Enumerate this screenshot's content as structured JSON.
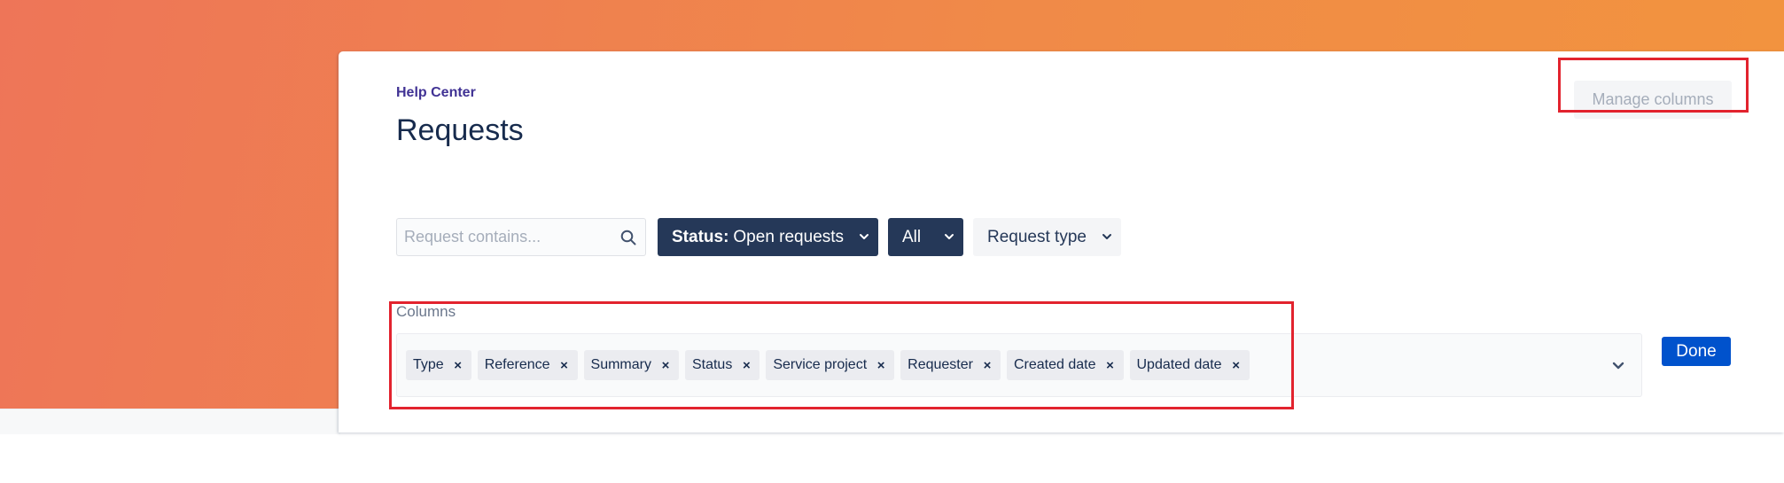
{
  "page": {
    "eyebrow": "Help Center",
    "title": "Requests"
  },
  "header": {
    "manage_columns_label": "Manage columns"
  },
  "filters": {
    "search_placeholder": "Request contains...",
    "status": {
      "prefix": "Status:",
      "value": "Open requests"
    },
    "scope": {
      "label": "All"
    },
    "request_type": {
      "label": "Request type"
    }
  },
  "columns_editor": {
    "label": "Columns",
    "chips": [
      {
        "label": "Type"
      },
      {
        "label": "Reference"
      },
      {
        "label": "Summary"
      },
      {
        "label": "Status"
      },
      {
        "label": "Service project"
      },
      {
        "label": "Requester"
      },
      {
        "label": "Created date"
      },
      {
        "label": "Updated date"
      }
    ],
    "remove_glyph": "×",
    "done_label": "Done"
  },
  "icons": {
    "search": "search-icon",
    "dropdown": "chevron-down-icon",
    "remove": "close-icon"
  },
  "colors": {
    "banner_start": "#ee7558",
    "banner_end": "#f2943e",
    "eyebrow": "#403294",
    "primary_text": "#172b4d",
    "dark_button": "#253858",
    "done_button": "#0052cc",
    "highlight": "#e2232e"
  }
}
